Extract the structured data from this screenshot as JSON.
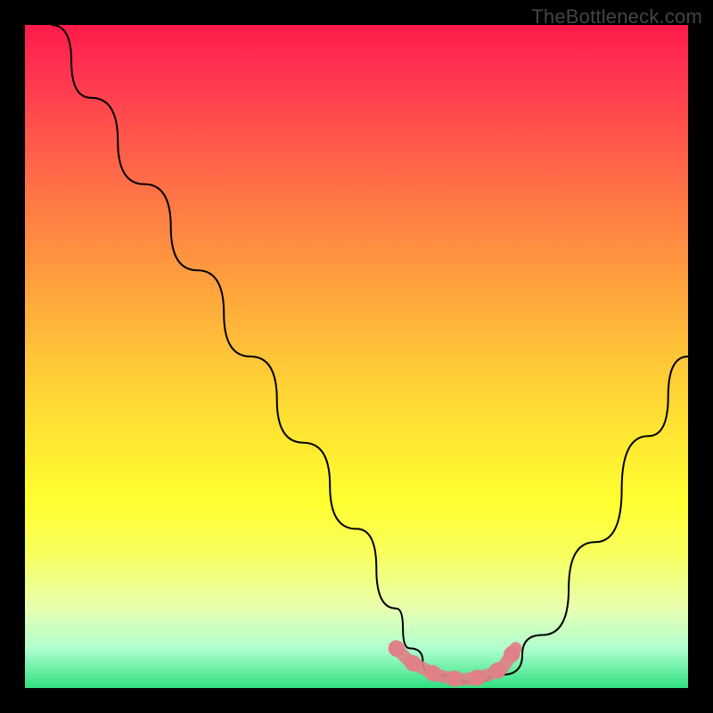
{
  "watermark": "TheBottleneck.com",
  "chart_data": {
    "type": "line",
    "title": "",
    "xlabel": "",
    "ylabel": "",
    "xlim": [
      0,
      100
    ],
    "ylim": [
      0,
      100
    ],
    "series": [
      {
        "name": "bottleneck-curve",
        "x": [
          4,
          10,
          18,
          26,
          34,
          42,
          50,
          56,
          58,
          62,
          66,
          68,
          72,
          78,
          86,
          94,
          100
        ],
        "y": [
          100,
          89,
          76,
          63,
          50,
          37,
          24,
          12,
          6,
          2,
          1,
          1,
          2,
          8,
          22,
          38,
          50
        ],
        "color": "#000000"
      }
    ],
    "annotations": [
      {
        "name": "optimal-zone-dots",
        "type": "scatter-line",
        "color": "#e08088",
        "x": [
          56,
          58,
          60,
          62,
          64,
          66,
          68,
          70,
          72,
          74
        ],
        "y": [
          6,
          4,
          3,
          2,
          1.5,
          1.3,
          1.5,
          2,
          3,
          6
        ]
      }
    ],
    "background": {
      "type": "gradient",
      "direction": "vertical",
      "stops": [
        {
          "pos": 0,
          "color": "#ff1a4a"
        },
        {
          "pos": 0.5,
          "color": "#ffe233"
        },
        {
          "pos": 1,
          "color": "#30e080"
        }
      ]
    }
  }
}
